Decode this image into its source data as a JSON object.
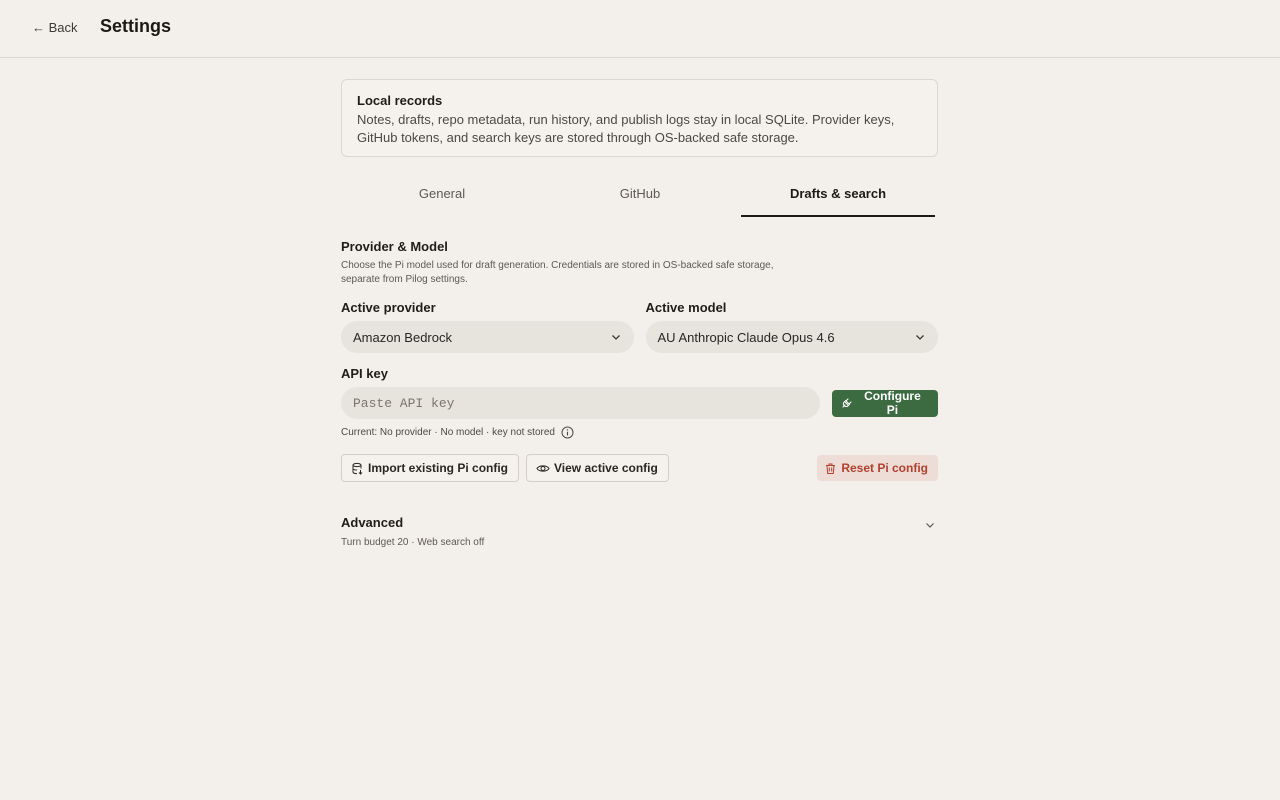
{
  "header": {
    "back_label": "← Back",
    "title": "Settings"
  },
  "notice": {
    "title": "Local records",
    "body": "Notes, drafts, repo metadata, run history, and publish logs stay in local SQLite. Provider keys, GitHub tokens, and search keys are stored through OS-backed safe storage."
  },
  "tabs": [
    {
      "label": "General",
      "active": false
    },
    {
      "label": "GitHub",
      "active": false
    },
    {
      "label": "Drafts & search",
      "active": true
    }
  ],
  "provider_model": {
    "title": "Provider & Model",
    "description": "Choose the Pi model used for draft generation. Credentials are stored in OS-backed safe storage, separate from Pilog settings.",
    "active_provider_label": "Active provider",
    "active_provider_value": "Amazon Bedrock",
    "active_model_label": "Active model",
    "active_model_value": "AU Anthropic Claude Opus 4.6",
    "api_key_label": "API key",
    "api_key_placeholder": "Paste API key",
    "configure_button": "Configure Pi",
    "status_text": "Current: No provider · No model · key not stored",
    "import_button": "Import existing Pi config",
    "view_button": "View active config",
    "reset_button": "Reset Pi config"
  },
  "advanced": {
    "title": "Advanced",
    "summary": "Turn budget 20 · Web search off"
  },
  "colors": {
    "background": "#f3f0ec",
    "primary": "#3c6b42",
    "danger_text": "#b3402f",
    "danger_bg": "#eedcd6"
  }
}
